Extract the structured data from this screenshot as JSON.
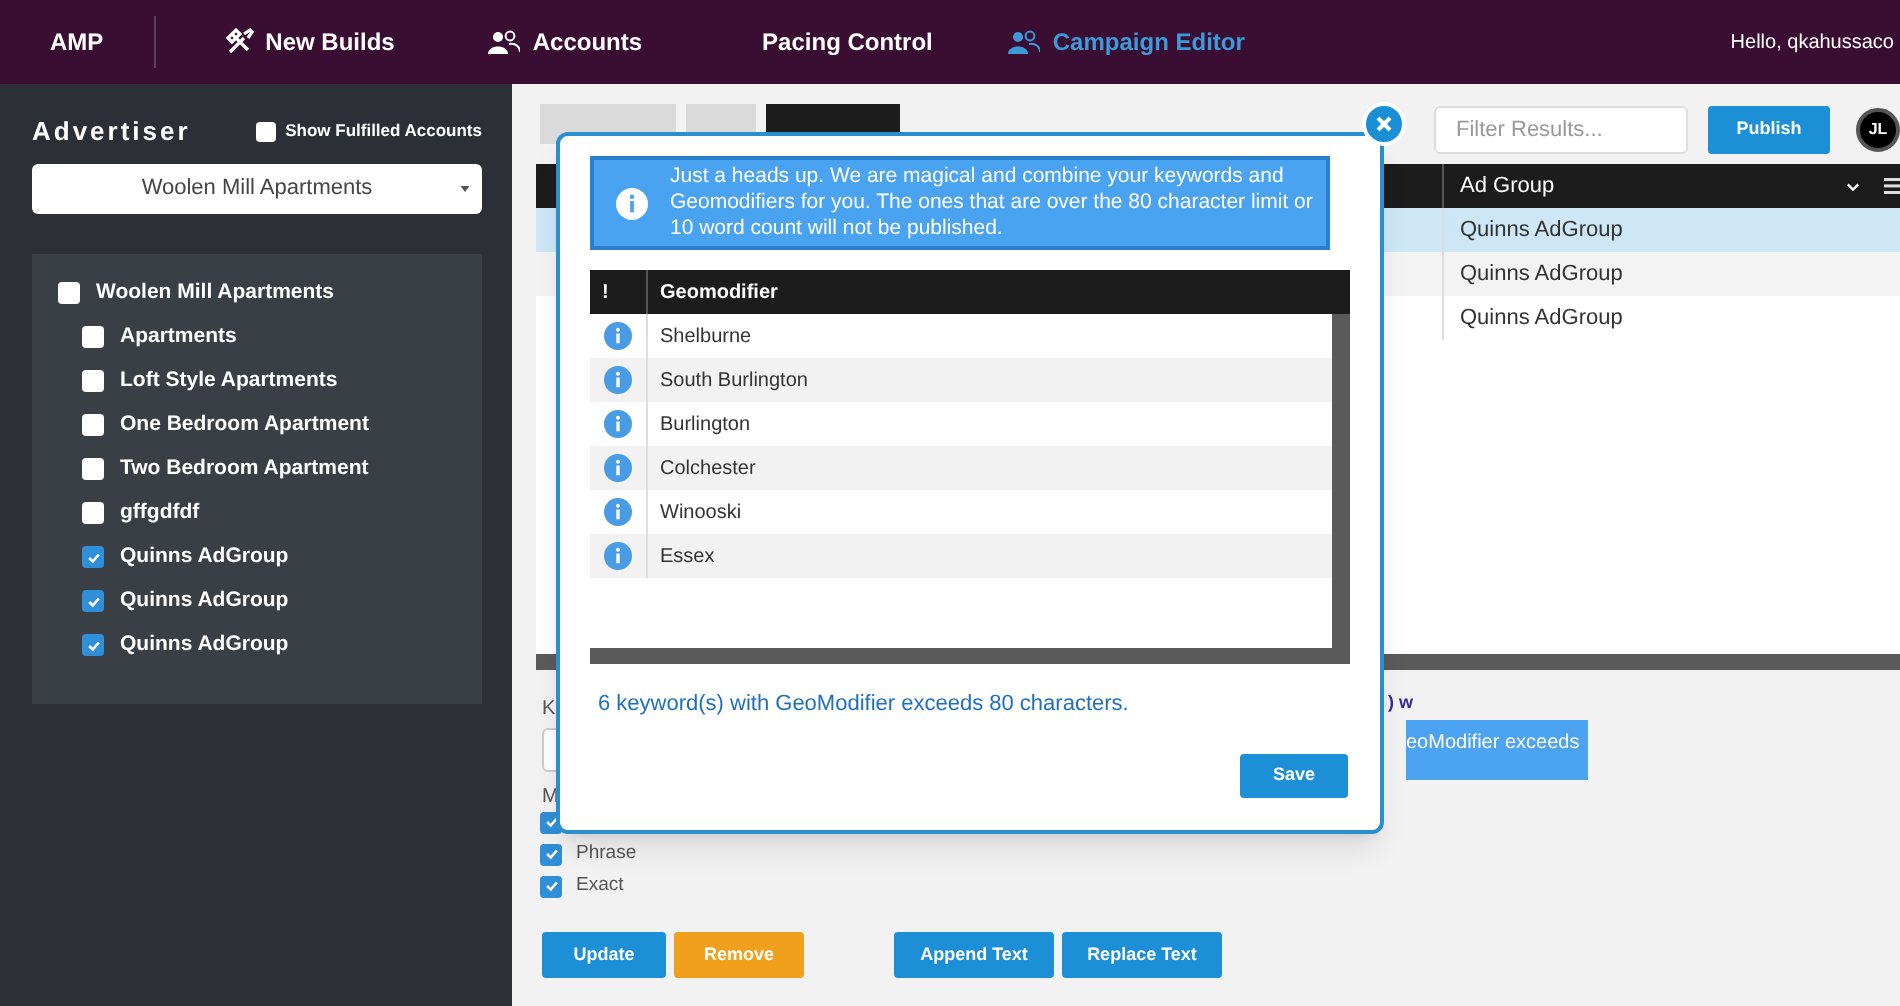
{
  "nav": {
    "brand": "AMP",
    "items": [
      {
        "label": "New Builds",
        "selected": false
      },
      {
        "label": "Accounts",
        "selected": false
      },
      {
        "label": "Pacing Control",
        "selected": false
      },
      {
        "label": "Campaign Editor",
        "selected": true
      }
    ],
    "greeting": "Hello, qkahussaco"
  },
  "sidebar": {
    "title": "Advertiser",
    "show_fulfilled": {
      "label": "Show Fulfilled Accounts",
      "checked": false
    },
    "advertiser_select": "Woolen Mill Apartments",
    "tree": [
      {
        "label": "Woolen Mill Apartments",
        "checked": false,
        "children": [
          {
            "label": "Apartments",
            "checked": false
          },
          {
            "label": "Loft Style Apartments",
            "checked": false
          },
          {
            "label": "One Bedroom Apartment",
            "checked": false
          },
          {
            "label": "Two Bedroom Apartment",
            "checked": false
          },
          {
            "label": "gffgdfdf",
            "checked": false
          },
          {
            "label": "Quinns AdGroup",
            "checked": true
          },
          {
            "label": "Quinns AdGroup",
            "checked": true
          },
          {
            "label": "Quinns AdGroup",
            "checked": true
          }
        ]
      }
    ]
  },
  "tabs": [
    {
      "selected": false
    },
    {
      "selected": false
    },
    {
      "selected": true
    }
  ],
  "filter": {
    "placeholder": "Filter Results..."
  },
  "publish_button": "Publish",
  "avatar": "JL",
  "table": {
    "columns": [
      "Ad Group"
    ],
    "rows": [
      {
        "ad_group": "Quinns AdGroup",
        "selected": true
      },
      {
        "ad_group": "Quinns AdGroup",
        "selected": false
      },
      {
        "ad_group": "Quinns AdGroup",
        "selected": false
      }
    ]
  },
  "form": {
    "label_1": "K",
    "label_2": "M",
    "match_types": [
      {
        "checked": true
      },
      {
        "label": "Phrase",
        "checked": true
      },
      {
        "label": "Exact",
        "checked": true
      }
    ],
    "buttons": [
      {
        "label": "Update",
        "kind": "primary"
      },
      {
        "label": "Remove",
        "kind": "warning"
      },
      {
        "label": "Append Text",
        "kind": "primary"
      },
      {
        "label": "Replace Text",
        "kind": "primary"
      }
    ],
    "notice_fragment": ") w",
    "tooltip_fragment": "eoModifier exceeds"
  },
  "modal": {
    "banner": "Just a heads up. We are magical and combine your keywords and Geomodifiers for you. The ones that are over the 80 character limit or 10 word count will not be published.",
    "columns": [
      "!",
      "Geomodifier"
    ],
    "rows": [
      "Shelburne",
      "South Burlington",
      "Burlington",
      "Colchester",
      "Winooski",
      "Essex"
    ],
    "message": "6 keyword(s) with GeoModifier exceeds 80 characters.",
    "save_button": "Save"
  }
}
